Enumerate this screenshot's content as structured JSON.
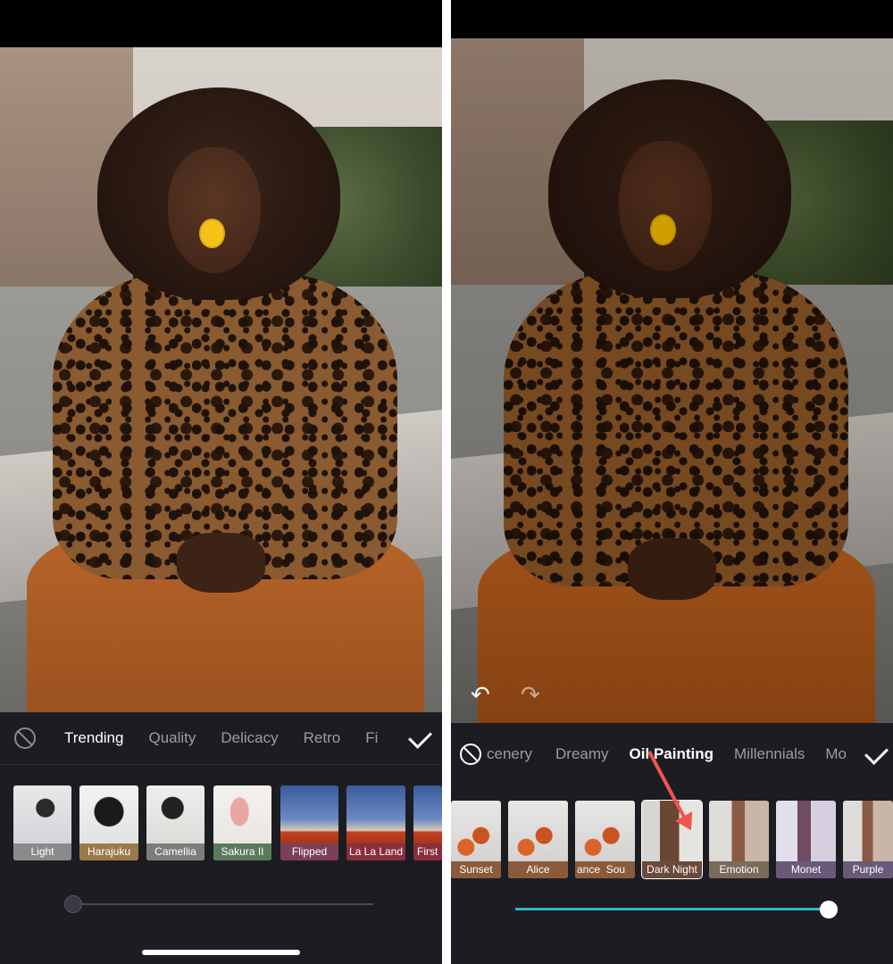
{
  "left": {
    "categories": [
      {
        "label": "Trending",
        "active": true
      },
      {
        "label": "Quality",
        "active": false
      },
      {
        "label": "Delicacy",
        "active": false
      },
      {
        "label": "Retro",
        "active": false
      },
      {
        "label": "Fi",
        "active": false
      }
    ],
    "filters": [
      {
        "label": "Light",
        "caption_color": "#8a8a8a",
        "thumb": "woman"
      },
      {
        "label": "Harajuku",
        "caption_color": "#9a7a4a",
        "thumb": "girl"
      },
      {
        "label": "Camellia",
        "caption_color": "#7d7d7d",
        "thumb": "camellia"
      },
      {
        "label": "Sakura II",
        "caption_color": "#5b7a5b",
        "thumb": "tulip"
      },
      {
        "label": "Flipped",
        "caption_color": "#7a4058",
        "thumb": "car"
      },
      {
        "label": "La La Land",
        "caption_color": "#8a2e3c",
        "thumb": "car"
      },
      {
        "label": "First",
        "caption_color": "#8a2e3c",
        "thumb": "car"
      }
    ],
    "intensity": 0
  },
  "right": {
    "categories": [
      {
        "label": "cenery",
        "active": false
      },
      {
        "label": "Dreamy",
        "active": false
      },
      {
        "label": "Oil Painting",
        "active": true
      },
      {
        "label": "Millennials",
        "active": false
      },
      {
        "label": "Mo",
        "active": false
      }
    ],
    "filters": [
      {
        "label": "Sunset",
        "caption_color": "#8a5a3a",
        "thumb": "fruit"
      },
      {
        "label": "Alice",
        "caption_color": "#8a5a3a",
        "thumb": "fruit"
      },
      {
        "label": "ance",
        "caption_color": "#8a5a3a",
        "thumb": "fruit"
      },
      {
        "label": "Sou",
        "caption_color": "#8a5a3a",
        "thumb": "fruit"
      },
      {
        "label": "Dark Night",
        "caption_color": "#6a4a3a",
        "thumb": "door",
        "selected": true
      },
      {
        "label": "Emotion",
        "caption_color": "#7a6a5a",
        "thumb": "frame"
      },
      {
        "label": "Monet",
        "caption_color": "#6a5a7a",
        "thumb": "monet"
      },
      {
        "label": "Purple",
        "caption_color": "#6a5a7a",
        "thumb": "frame"
      }
    ],
    "intensity": 1,
    "accent": "#2bb8c6",
    "annotation_color": "#f0554f"
  }
}
